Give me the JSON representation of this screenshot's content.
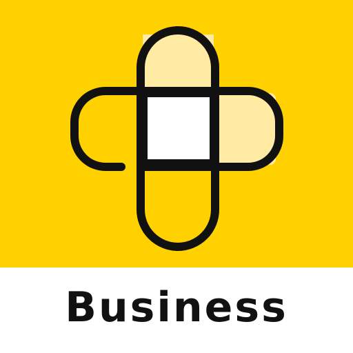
{
  "label": "Business",
  "colors": {
    "background": "#FFD100",
    "strip": "#FFFFFF",
    "outline": "#111111",
    "plaster_light": "#FFEBA3",
    "center_pad": "#FFFFFF",
    "text": "#111111"
  },
  "icon": {
    "name": "bandage-cross-icon"
  }
}
